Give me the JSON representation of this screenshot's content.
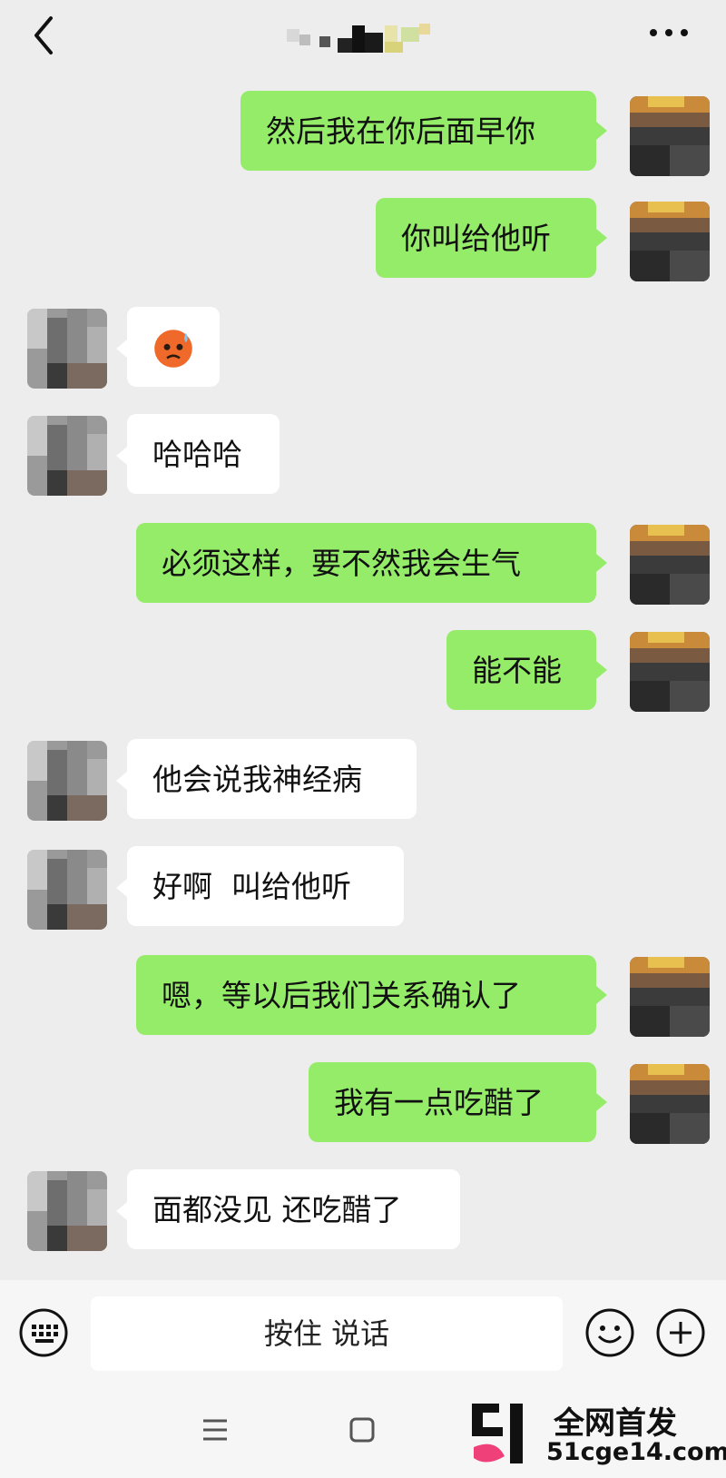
{
  "header": {
    "back_icon": "chevron-left-icon",
    "more_icon": "ellipsis-icon"
  },
  "messages": [
    {
      "side": "out",
      "text": "然后我在你后面早你"
    },
    {
      "side": "out",
      "text": "你叫给他听"
    },
    {
      "side": "in",
      "emoji": "sweat-face-emoji"
    },
    {
      "side": "in",
      "text": "哈哈哈"
    },
    {
      "side": "out",
      "text": "必须这样，要不然我会生气"
    },
    {
      "side": "out",
      "text": "能不能"
    },
    {
      "side": "in",
      "text": "他会说我神经病"
    },
    {
      "side": "in",
      "text": "好啊  叫给他听"
    },
    {
      "side": "out",
      "text": "嗯，等以后我们关系确认了"
    },
    {
      "side": "out",
      "text": "我有一点吃醋了"
    },
    {
      "side": "in",
      "text": "面都没见 还吃醋了"
    }
  ],
  "input_bar": {
    "keyboard_icon": "keyboard-icon",
    "voice_label": "按住 说话",
    "emoji_icon": "smiley-icon",
    "add_icon": "plus-icon"
  },
  "nav_bar": {
    "menu_icon": "menu-icon",
    "home_icon": "square-icon"
  },
  "watermark": {
    "line1": "全网首发",
    "line2": "51cge14.com"
  },
  "colors": {
    "outgoing_bubble": "#95ec69",
    "incoming_bubble": "#ffffff",
    "background": "#ededed"
  }
}
